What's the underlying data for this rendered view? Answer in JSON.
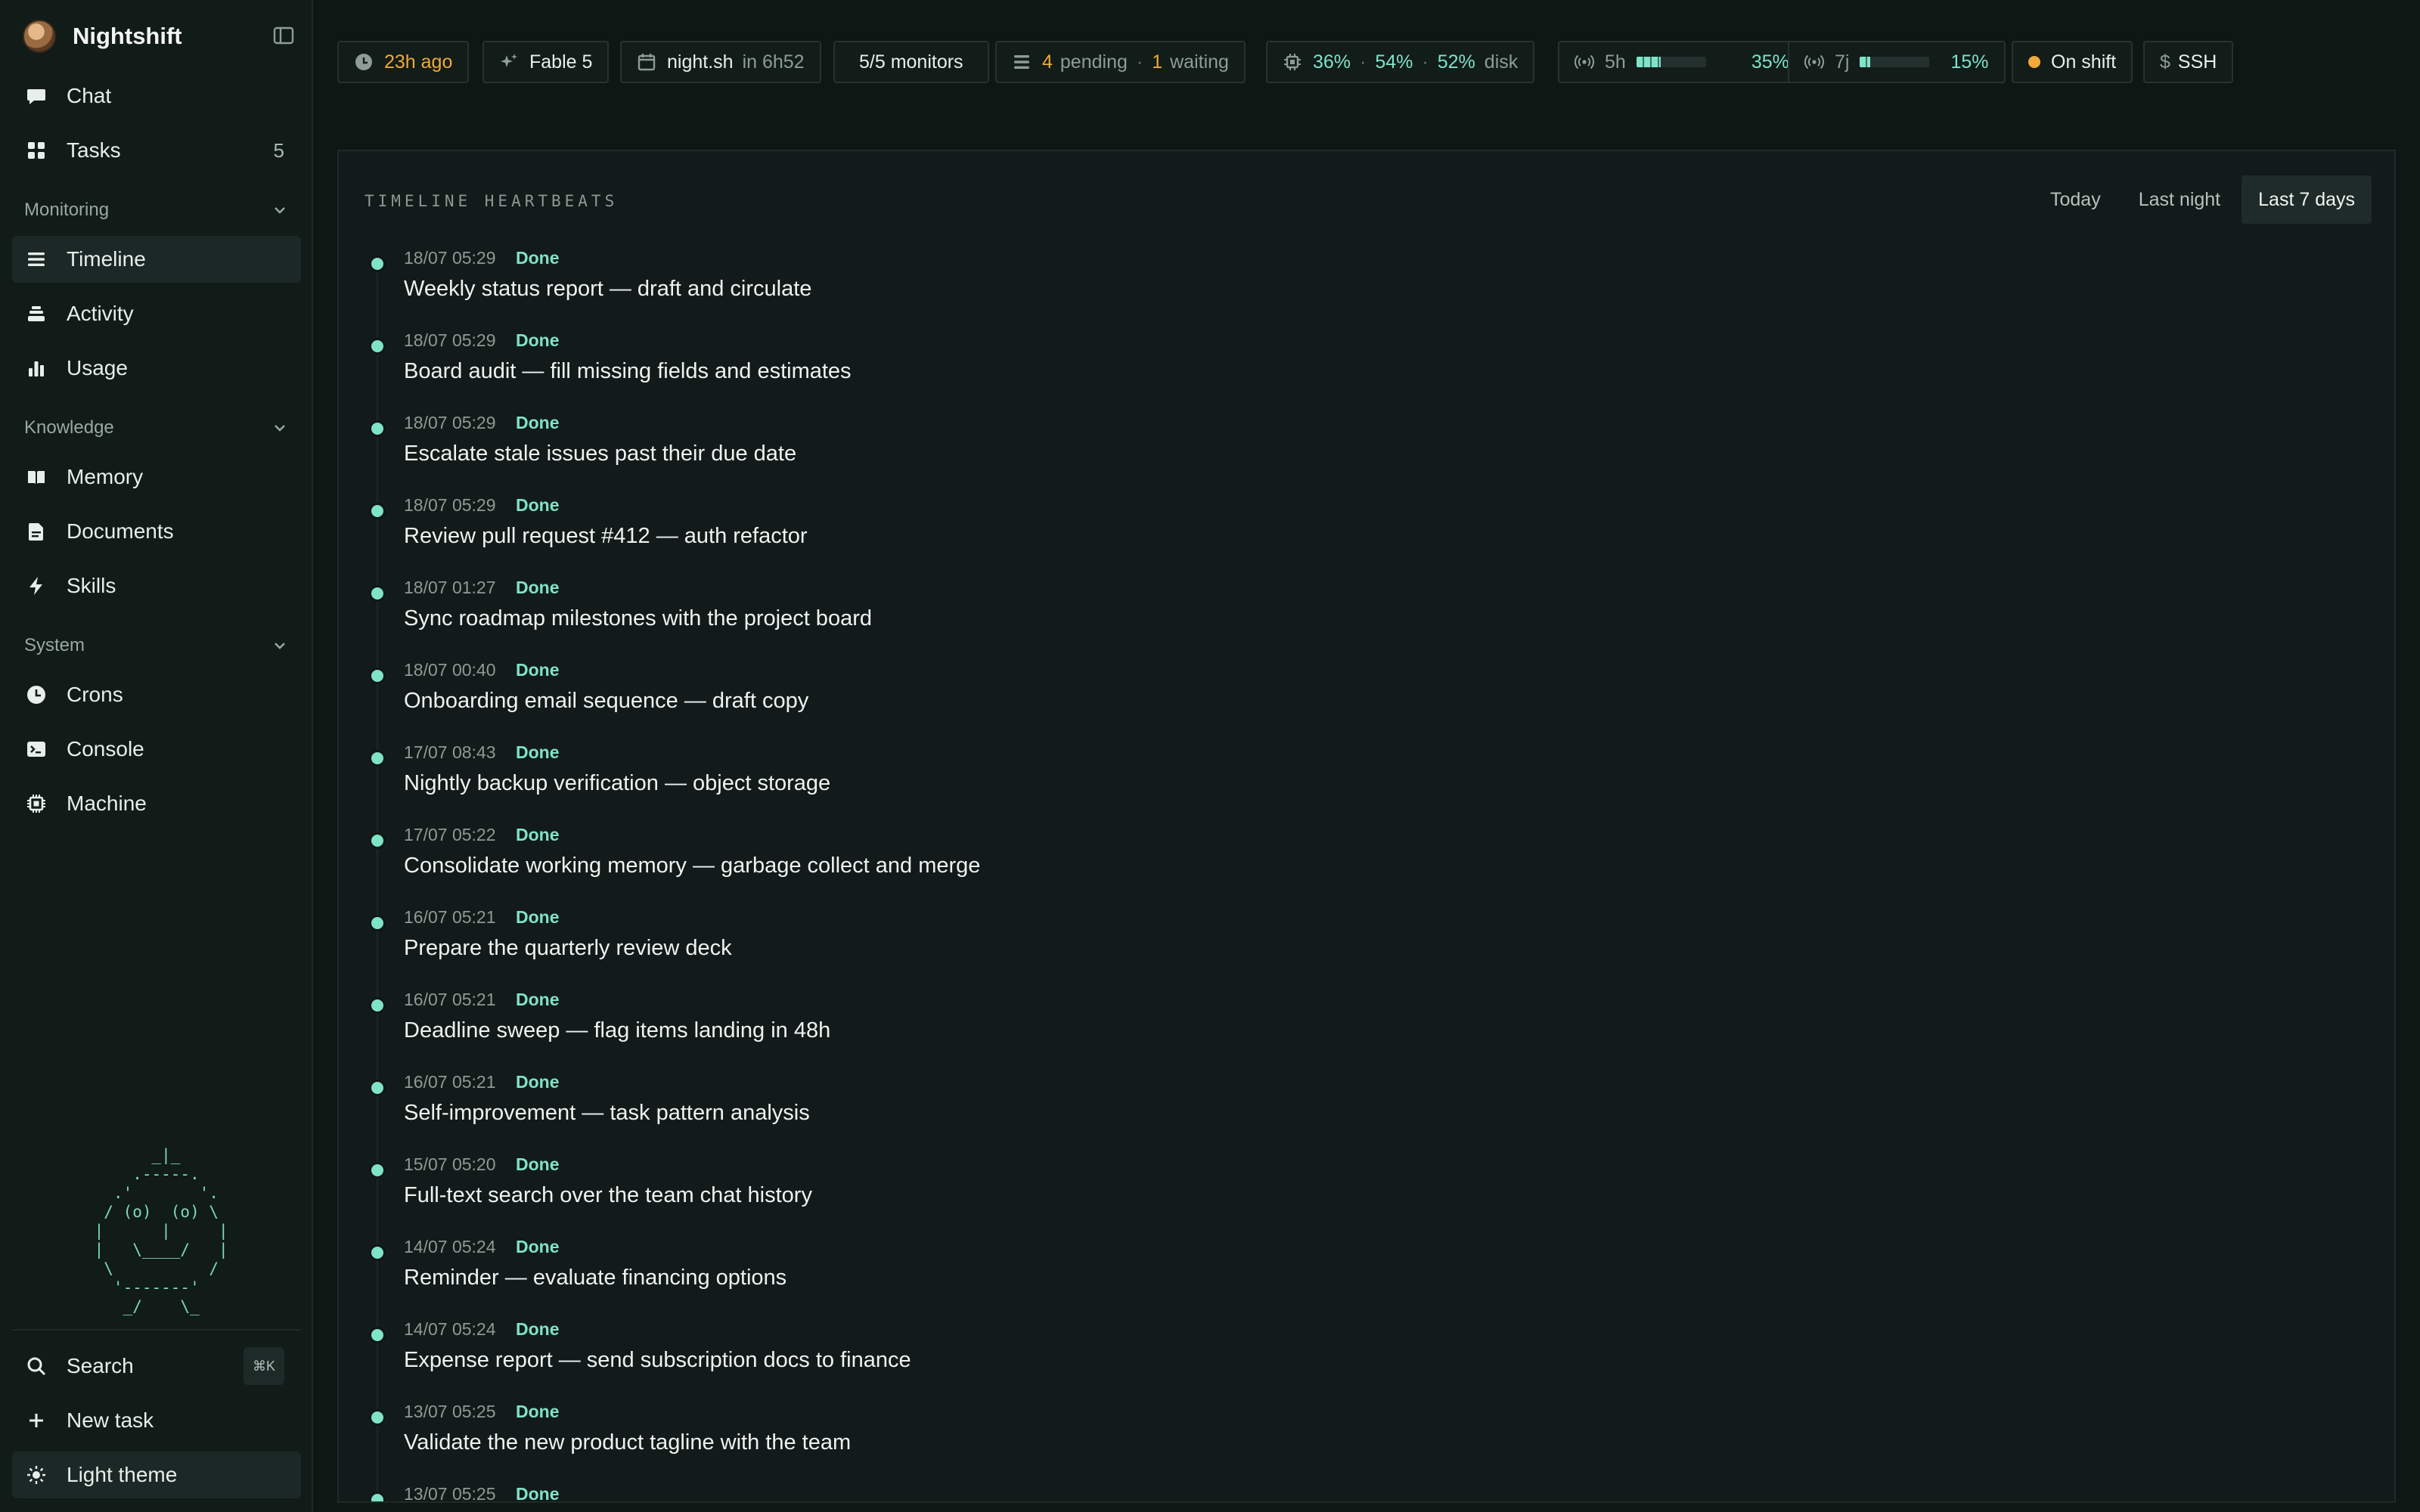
{
  "app": {
    "name": "Nightshift"
  },
  "sidebar": {
    "top_items": [
      {
        "label": "Chat",
        "icon": "chat-icon"
      },
      {
        "label": "Tasks",
        "icon": "grid-icon",
        "count": "5"
      }
    ],
    "sections": [
      {
        "title": "Monitoring",
        "items": [
          {
            "label": "Timeline",
            "icon": "list-icon",
            "active": true
          },
          {
            "label": "Activity",
            "icon": "stack-icon"
          },
          {
            "label": "Usage",
            "icon": "bar-chart-icon"
          }
        ]
      },
      {
        "title": "Knowledge",
        "items": [
          {
            "label": "Memory",
            "icon": "book-icon"
          },
          {
            "label": "Documents",
            "icon": "document-icon"
          },
          {
            "label": "Skills",
            "icon": "lightning-icon"
          }
        ]
      },
      {
        "title": "System",
        "items": [
          {
            "label": "Crons",
            "icon": "clock-icon"
          },
          {
            "label": "Console",
            "icon": "terminal-icon"
          },
          {
            "label": "Machine",
            "icon": "chip-icon"
          }
        ]
      }
    ],
    "mascot": "       _|_\n     .-----.\n   .'       '.\n  / (o)  (o) \\\n |      |     |\n |   \\____/   |\n  \\          /\n   '-------'\n    _/    \\_",
    "bottom": {
      "search_label": "Search",
      "search_shortcut": "⌘K",
      "new_task_label": "New task",
      "theme_label": "Light theme"
    }
  },
  "topbar": {
    "last_run": "23h ago",
    "model": "Fable 5",
    "next_schedule_name": "night.sh",
    "next_schedule_eta": "in 6h52",
    "monitors": "5/5 monitors",
    "pending_count": "4",
    "pending_label": "pending",
    "waiting_count": "1",
    "waiting_label": "waiting",
    "cpu": "36%",
    "mem": "54%",
    "disk": "52%",
    "disk_label": "disk",
    "usage_5h_label": "5h",
    "usage_5h_value": "35%",
    "usage_5h_fraction": 0.35,
    "usage_7d_label": "7j",
    "usage_7d_value": "15%",
    "usage_7d_fraction": 0.15,
    "shift_status": "On shift",
    "ssh_label": "SSH",
    "ssh_prefix": "$"
  },
  "panel": {
    "title": "TIMELINE HEARTBEATS",
    "tabs": [
      "Today",
      "Last night",
      "Last 7 days"
    ],
    "active_tab": 2,
    "entries": [
      {
        "time": "18/07 05:29",
        "status": "Done",
        "text": "Weekly status report — draft and circulate"
      },
      {
        "time": "18/07 05:29",
        "status": "Done",
        "text": "Board audit — fill missing fields and estimates"
      },
      {
        "time": "18/07 05:29",
        "status": "Done",
        "text": "Escalate stale issues past their due date"
      },
      {
        "time": "18/07 05:29",
        "status": "Done",
        "text": "Review pull request #412 — auth refactor"
      },
      {
        "time": "18/07 01:27",
        "status": "Done",
        "text": "Sync roadmap milestones with the project board"
      },
      {
        "time": "18/07 00:40",
        "status": "Done",
        "text": "Onboarding email sequence — draft copy"
      },
      {
        "time": "17/07 08:43",
        "status": "Done",
        "text": "Nightly backup verification — object storage"
      },
      {
        "time": "17/07 05:22",
        "status": "Done",
        "text": "Consolidate working memory — garbage collect and merge"
      },
      {
        "time": "16/07 05:21",
        "status": "Done",
        "text": "Prepare the quarterly review deck"
      },
      {
        "time": "16/07 05:21",
        "status": "Done",
        "text": "Deadline sweep — flag items landing in 48h"
      },
      {
        "time": "16/07 05:21",
        "status": "Done",
        "text": "Self-improvement — task pattern analysis"
      },
      {
        "time": "15/07 05:20",
        "status": "Done",
        "text": "Full-text search over the team chat history"
      },
      {
        "time": "14/07 05:24",
        "status": "Done",
        "text": "Reminder — evaluate financing options"
      },
      {
        "time": "14/07 05:24",
        "status": "Done",
        "text": "Expense report — send subscription docs to finance"
      },
      {
        "time": "13/07 05:25",
        "status": "Done",
        "text": "Validate the new product tagline with the team"
      },
      {
        "time": "13/07 05:25",
        "status": "Done",
        "text": ""
      }
    ]
  },
  "colors": {
    "accent": "#7fe3c8",
    "warning": "#f0a93a",
    "background": "#0f1715"
  }
}
